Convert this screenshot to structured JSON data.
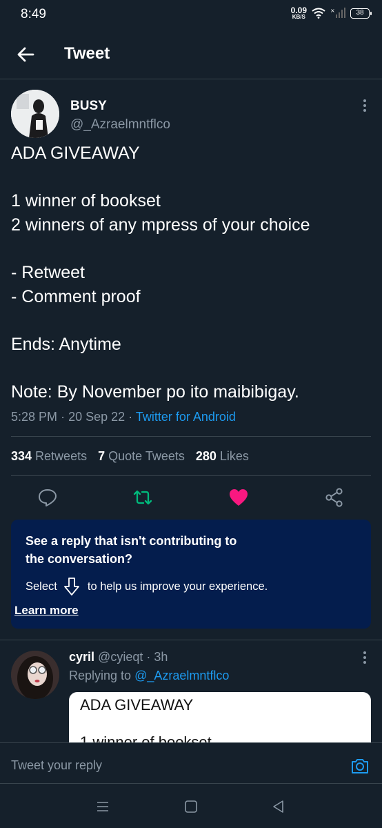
{
  "status_bar": {
    "time": "8:49",
    "net_speed": "0.09",
    "net_unit": "KB/S",
    "battery": "38"
  },
  "header": {
    "title": "Tweet"
  },
  "tweet": {
    "display_name": "BUSY",
    "handle": "@_Azraelmntflco",
    "lines": [
      "ADA GIVEAWAY",
      "",
      "1 winner of bookset",
      "2 winners of any mpress of your choice",
      "",
      "- Retweet",
      "- Comment proof",
      "",
      "Ends: Anytime",
      "",
      "Note: By November po ito maibibigay."
    ],
    "time": "5:28 PM",
    "date": "20 Sep 22",
    "source": "Twitter for Android",
    "retweets": "334",
    "retweets_label": "Retweets",
    "quotes": "7",
    "quotes_label": "Quote Tweets",
    "likes": "280",
    "likes_label": "Likes"
  },
  "colors": {
    "background": "#15202b",
    "accent": "#1d9bf0",
    "like": "#f91880",
    "retweet": "#00ba7c",
    "notice": "#041d4d"
  },
  "notice": {
    "title": "See a reply that isn't contributing to the conversation?",
    "select": "Select",
    "help": "to help us improve your experience.",
    "learn_more": "Learn more"
  },
  "reply": {
    "name": "cyril",
    "handle": "@cyieqt",
    "time": "3h",
    "replying_prefix": "Replying to",
    "replying_handle": "@_Azraelmntflco",
    "quote_lines": [
      "ADA GIVEAWAY",
      "1 winner of bookset"
    ]
  },
  "reply_bar": {
    "placeholder": "Tweet your reply"
  }
}
